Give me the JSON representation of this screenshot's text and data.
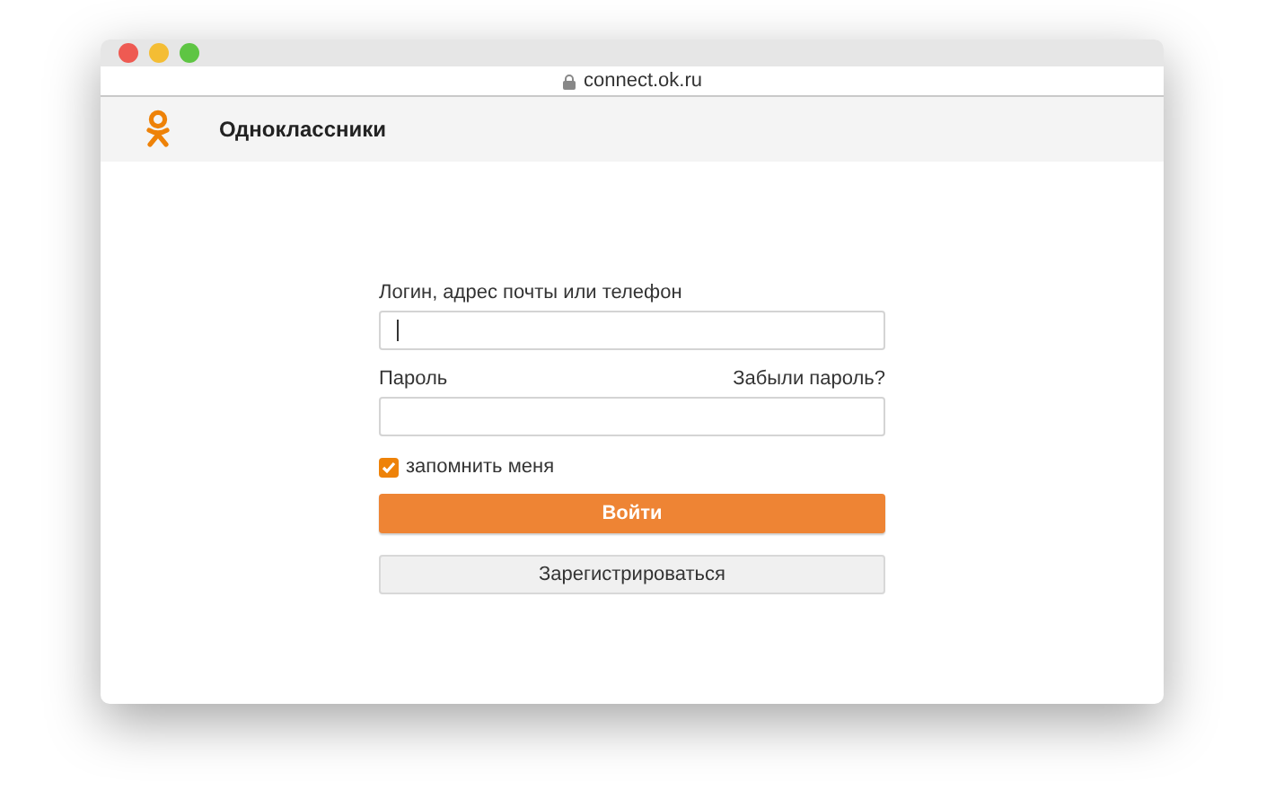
{
  "window": {
    "url": "connect.ok.ru"
  },
  "header": {
    "title": "Одноклассники"
  },
  "form": {
    "login": {
      "label": "Логин, адрес почты или телефон",
      "focused": true
    },
    "password": {
      "label": "Пароль",
      "focused": false
    },
    "forgot_link": "Забыли пароль?",
    "remember": {
      "label": "запомнить меня",
      "checked": true
    },
    "buttons": [
      {
        "kind": "primary",
        "label": "Войти"
      },
      {
        "kind": "secondary",
        "label": "Зарегистрироваться"
      }
    ]
  }
}
